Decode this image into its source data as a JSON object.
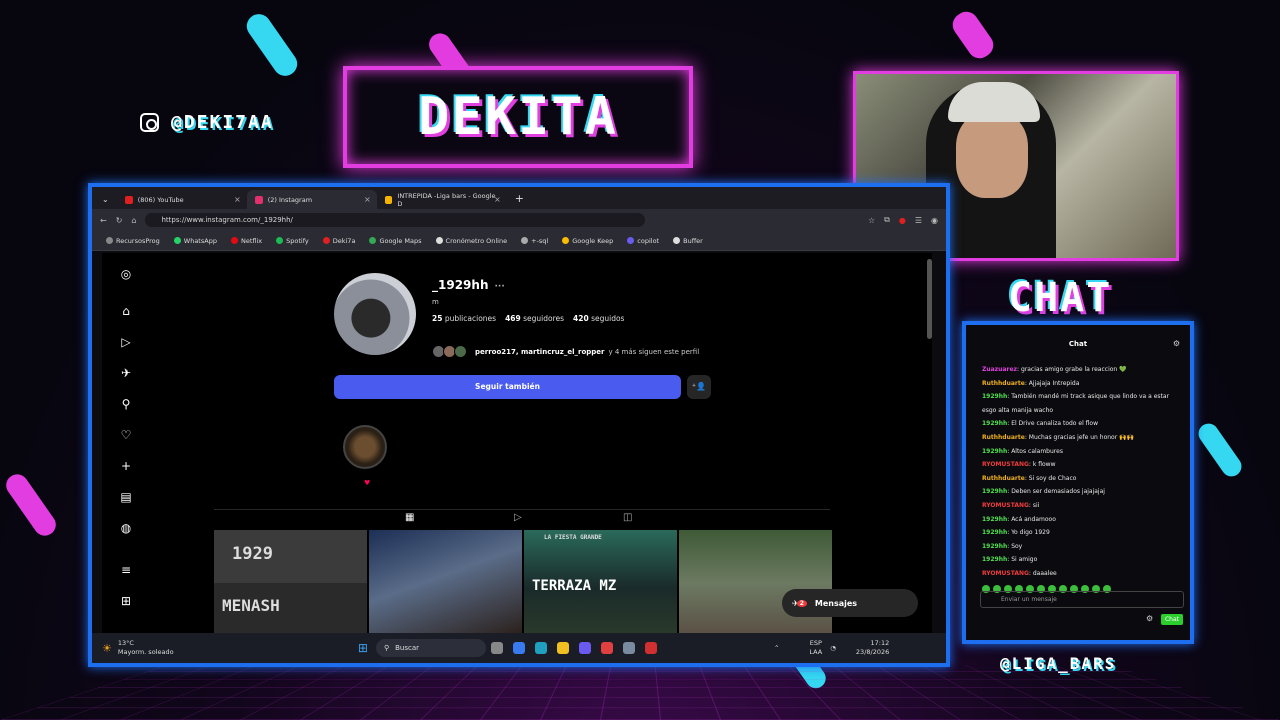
{
  "overlay": {
    "brand": "DEKITA",
    "instagram_handle": "@DEKI7AA",
    "chat_title": "CHAT",
    "bottom_handle": "@LIGA_BARS"
  },
  "browser": {
    "tabs": [
      {
        "label": "(806) YouTube",
        "color": "#e02020"
      },
      {
        "label": "(2) Instagram",
        "color": "#e1306c"
      },
      {
        "label": "INTREPIDA -Liga bars - Google D",
        "color": "#f4b400"
      }
    ],
    "new_tab": "+",
    "url": "https://www.instagram.com/_1929hh/",
    "bookmarks": [
      {
        "label": "RecursosProg",
        "color": "#888"
      },
      {
        "label": "WhatsApp",
        "color": "#25d366"
      },
      {
        "label": "Netflix",
        "color": "#e50914"
      },
      {
        "label": "Spotify",
        "color": "#1db954"
      },
      {
        "label": "Deki7a",
        "color": "#e02020"
      },
      {
        "label": "Google Maps",
        "color": "#34a853"
      },
      {
        "label": "Cronómetro Online",
        "color": "#ddd"
      },
      {
        "label": "+-sql",
        "color": "#aaa"
      },
      {
        "label": "Google Keep",
        "color": "#fbbc04"
      },
      {
        "label": "copilot",
        "color": "#6b5cf0"
      },
      {
        "label": "Buffer",
        "color": "#ddd"
      }
    ]
  },
  "profile": {
    "username": "_1929hh",
    "more": "···",
    "bio": "m",
    "posts_count": "25",
    "posts_label": "publicaciones",
    "followers_count": "469",
    "followers_label": "seguidores",
    "following_count": "420",
    "following_label": "seguidos",
    "followed_by_names": "perroo217, martincruz_el_ropper",
    "followed_by_rest": "y 4 más siguen este perfil",
    "follow_button": "Seguir también",
    "messages_label": "Mensajes",
    "messages_badge": "2"
  },
  "posts": [
    {
      "top": "1929",
      "bottom": "MENASH"
    },
    {
      "top": "",
      "bottom": ""
    },
    {
      "top": "LA FIESTA GRANDE",
      "bottom": "TERRAZA MZ"
    },
    {
      "top": "",
      "bottom": ""
    }
  ],
  "chat": {
    "header": "Chat",
    "messages": [
      {
        "user": "Zuazuarez",
        "color": "#e040e0",
        "text": "gracias amigo grabe la reaccion 💚"
      },
      {
        "user": "Ruthhduarte",
        "color": "#f0b020",
        "text": "Ajjajaja Intrepida"
      },
      {
        "user": "1929hh",
        "color": "#4fe04f",
        "text": "También mandé mi track asique que lindo va a estar esgo alta manija wacho"
      },
      {
        "user": "1929hh",
        "color": "#4fe04f",
        "text": "El Drive canaliza todo el flow"
      },
      {
        "user": "Ruthhduarte",
        "color": "#f0b020",
        "text": "Muchas gracias jefe un honor 🙌🙌"
      },
      {
        "user": "1929hh",
        "color": "#4fe04f",
        "text": "Altos calambures"
      },
      {
        "user": "RYOMUSTANG",
        "color": "#f03c3c",
        "text": "k floww"
      },
      {
        "user": "Ruthhduarte",
        "color": "#f0b020",
        "text": "Si soy de Chaco"
      },
      {
        "user": "1929hh",
        "color": "#4fe04f",
        "text": "Deben ser demasiados jajajajaj"
      },
      {
        "user": "RYOMUSTANG",
        "color": "#f03c3c",
        "text": "sii"
      },
      {
        "user": "1929hh",
        "color": "#4fe04f",
        "text": "Acá andamooo"
      },
      {
        "user": "1929hh",
        "color": "#4fe04f",
        "text": "Yo digo 1929"
      },
      {
        "user": "1929hh",
        "color": "#4fe04f",
        "text": "Soy"
      },
      {
        "user": "1929hh",
        "color": "#4fe04f",
        "text": "Si amigo"
      },
      {
        "user": "RYOMUSTANG",
        "color": "#f03c3c",
        "text": "daaalee"
      }
    ],
    "input_placeholder": "Enviar un mensaje",
    "send_label": "Chat"
  },
  "taskbar": {
    "temp": "13°C",
    "weather": "Mayorm. soleado",
    "search": "Buscar",
    "lang": "ESP",
    "lang2": "LAA",
    "time": "17:12",
    "date": "23/8/2026"
  }
}
